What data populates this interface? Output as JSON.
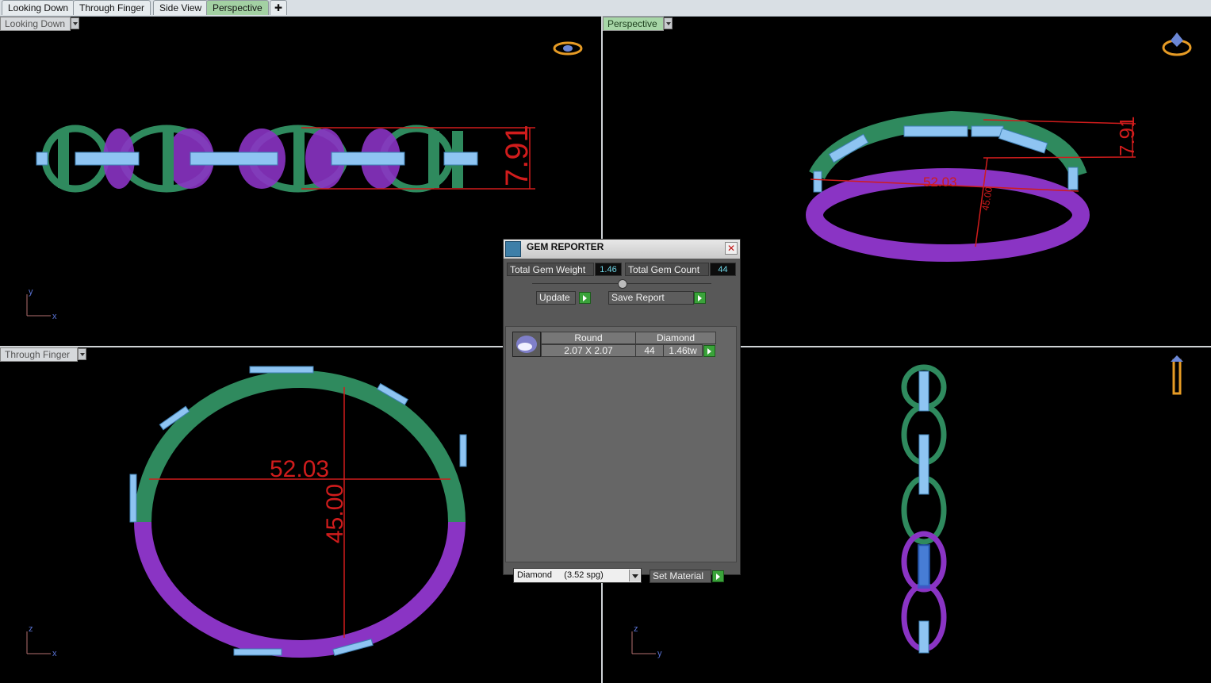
{
  "tabs": [
    {
      "label": "Looking Down",
      "active": false
    },
    {
      "label": "Through Finger",
      "active": false
    },
    {
      "label": "Side View",
      "active": false
    },
    {
      "label": "Perspective",
      "active": true
    }
  ],
  "add_tab_icon": "plus-icon",
  "viewports": {
    "top_left": {
      "label": "Looking Down",
      "dimension": "7.91",
      "axis1": "x",
      "axis2": "y"
    },
    "top_right": {
      "label": "Perspective",
      "dimension_height": "7.91",
      "dimension_width": "52.03",
      "dimension_depth": "45.00"
    },
    "bottom_left": {
      "label": "Through Finger",
      "dimension_width": "52.03",
      "dimension_height": "45.00",
      "axis1": "x",
      "axis2": "z"
    },
    "bottom_right": {
      "axis1": "y",
      "axis2": "z"
    }
  },
  "gem_reporter": {
    "title": "GEM REPORTER",
    "total_weight_label": "Total Gem Weight",
    "total_weight_value": "1.46",
    "total_count_label": "Total Gem Count",
    "total_count_value": "44",
    "update_label": "Update",
    "save_report_label": "Save Report",
    "row": {
      "shape": "Round",
      "material": "Diamond",
      "size": "2.07 X 2.07",
      "count": "44",
      "weight": "1.46tw"
    },
    "material_select": "Diamond     (3.52 spg)",
    "set_material_label": "Set Material"
  },
  "colors": {
    "green": "#2f8a5e",
    "purple": "#8a34c4",
    "blue_gem": "#8ec4f2",
    "dimension_red": "#d01c1c",
    "selected_tab": "#a3d1a3"
  }
}
